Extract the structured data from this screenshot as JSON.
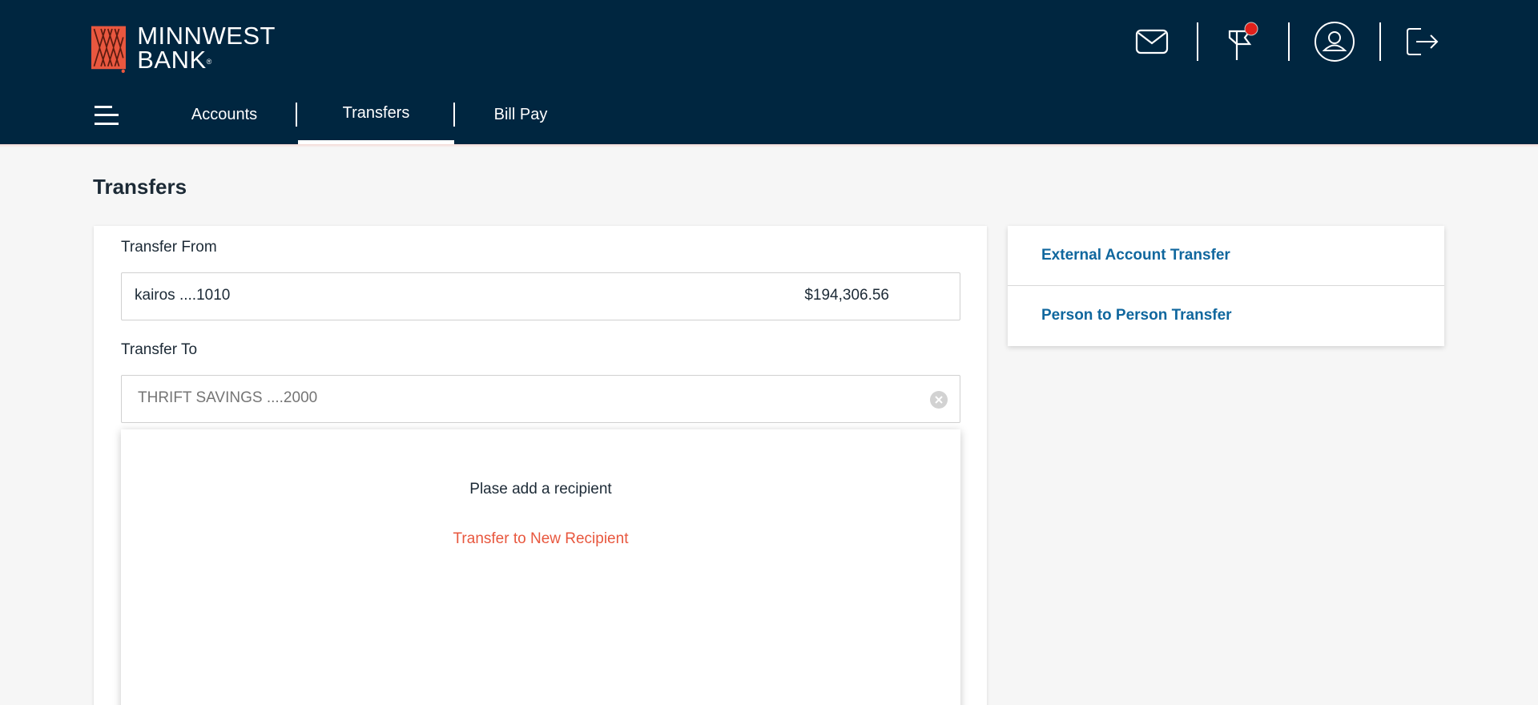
{
  "brand": {
    "name_line1": "MINNWEST",
    "name_line2": "BANK",
    "registered": "®",
    "logo_color": "#e9573f"
  },
  "header_icons": {
    "mail": "mail-icon",
    "alerts": "flag-icon",
    "alerts_badge_color": "#e0201b",
    "profile": "user-circle-icon",
    "logout": "logout-icon"
  },
  "nav": {
    "menu_icon": "menu-icon",
    "items": [
      {
        "label": "Accounts"
      },
      {
        "label": "Transfers",
        "active": true
      },
      {
        "label": "Bill Pay"
      }
    ]
  },
  "page": {
    "title": "Transfers"
  },
  "transfer_form": {
    "from_label": "Transfer From",
    "from_account": "kairos ....1010",
    "from_balance": "$194,306.56",
    "to_label": "Transfer To",
    "to_placeholder": "THRIFT SAVINGS ....2000"
  },
  "recipient_dropdown": {
    "message": "Plase add a recipient",
    "new_recipient_link": "Transfer to New Recipient"
  },
  "side_links": [
    {
      "label": "External Account Transfer"
    },
    {
      "label": "Person to Person Transfer"
    }
  ],
  "colors": {
    "header_bg": "#002640",
    "link_blue": "#10679e",
    "accent_orange": "#e8573e",
    "page_bg": "#f6f6f6"
  }
}
